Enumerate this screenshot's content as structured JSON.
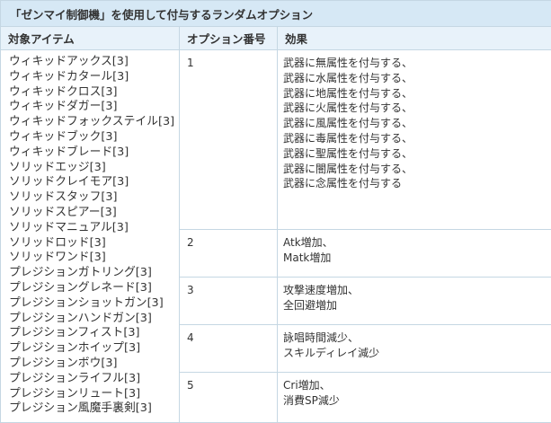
{
  "table_title": "「ゼンマイ制御機」を使用して付与するランダムオプション",
  "headers": {
    "items": "対象アイテム",
    "option_no": "オプション番号",
    "effect": "効果"
  },
  "items": [
    "ウィキッドアックス[3]",
    "ウィキッドカタール[3]",
    "ウィキッドクロス[3]",
    "ウィキッドダガー[3]",
    "ウィキッドフォックステイル[3]",
    "ウィキッドブック[3]",
    "ウィキッドブレード[3]",
    "ソリッドエッジ[3]",
    "ソリッドクレイモア[3]",
    "ソリッドスタッフ[3]",
    "ソリッドスピアー[3]",
    "ソリッドマニュアル[3]",
    "ソリッドロッド[3]",
    "ソリッドワンド[3]",
    "プレジションガトリング[3]",
    "プレジショングレネード[3]",
    "プレジションショットガン[3]",
    "プレジションハンドガン[3]",
    "プレジションフィスト[3]",
    "プレジションホイップ[3]",
    "プレジションボウ[3]",
    "プレジションライフル[3]",
    "プレジションリュート[3]",
    "プレジション風魔手裏剣[3]"
  ],
  "options": [
    {
      "number": "1",
      "effects": [
        "武器に無属性を付与する、",
        "武器に水属性を付与する、",
        "武器に地属性を付与する、",
        "武器に火属性を付与する、",
        "武器に風属性を付与する、",
        "武器に毒属性を付与する、",
        "武器に聖属性を付与する、",
        "武器に闇属性を付与する、",
        "武器に念属性を付与する"
      ]
    },
    {
      "number": "2",
      "effects": [
        "Atk増加、",
        "Matk増加"
      ]
    },
    {
      "number": "3",
      "effects": [
        "攻撃速度増加、",
        "全回避増加"
      ]
    },
    {
      "number": "4",
      "effects": [
        "詠唱時間減少、",
        "スキルディレイ減少"
      ]
    },
    {
      "number": "5",
      "effects": [
        "Cri増加、",
        "消費SP減少"
      ]
    }
  ]
}
